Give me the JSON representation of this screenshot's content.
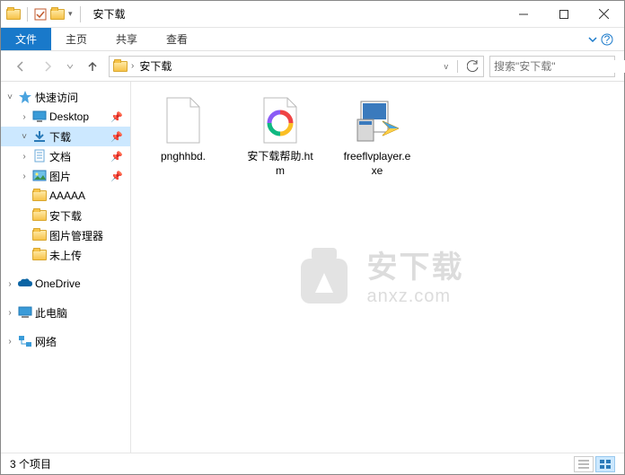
{
  "title": "安下载",
  "ribbon": {
    "file": "文件",
    "tabs": [
      "主页",
      "共享",
      "查看"
    ]
  },
  "address": {
    "root_icon": "folder",
    "crumbs": [
      "安下载"
    ]
  },
  "search": {
    "placeholder": "搜索\"安下载\""
  },
  "sidebar": {
    "quick_access": "快速访问",
    "items": [
      {
        "label": "Desktop",
        "icon": "desktop",
        "pinned": true
      },
      {
        "label": "下载",
        "icon": "downloads",
        "pinned": true,
        "selected": true
      },
      {
        "label": "文档",
        "icon": "document",
        "pinned": true
      },
      {
        "label": "图片",
        "icon": "pictures",
        "pinned": true
      },
      {
        "label": "AAAAA",
        "icon": "folder",
        "pinned": false
      },
      {
        "label": "安下载",
        "icon": "folder",
        "pinned": false
      },
      {
        "label": "图片管理器",
        "icon": "folder",
        "pinned": false
      },
      {
        "label": "未上传",
        "icon": "folder",
        "pinned": false
      }
    ],
    "onedrive": "OneDrive",
    "thispc": "此电脑",
    "network": "网络"
  },
  "files": [
    {
      "name": "pnghhbd.",
      "type": "blank"
    },
    {
      "name": "安下载帮助.htm",
      "type": "htm"
    },
    {
      "name": "freeflvplayer.exe",
      "type": "exe"
    }
  ],
  "status": {
    "count": "3 个项目"
  },
  "watermark": {
    "cn": "安下载",
    "en": "anxz.com"
  }
}
